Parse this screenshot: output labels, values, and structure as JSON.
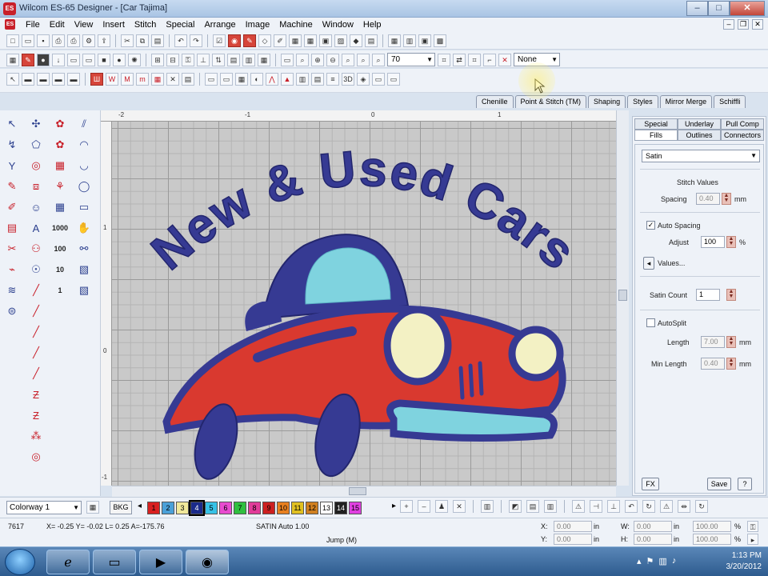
{
  "window": {
    "title": "Wilcom ES-65 Designer - [Car      Tajima]",
    "controls": [
      "–",
      "□",
      "✕"
    ]
  },
  "menu": {
    "items": [
      "File",
      "Edit",
      "View",
      "Insert",
      "Stitch",
      "Special",
      "Arrange",
      "Image",
      "Machine",
      "Window",
      "Help"
    ]
  },
  "toolbar2": {
    "zoom_value": "70",
    "filter_value": "None"
  },
  "docker_tabs": [
    "Chenille",
    "Point & Stitch (TM)",
    "Shaping",
    "Styles",
    "Mirror Merge",
    "Schiffli"
  ],
  "design": {
    "text": "New & Used Cars",
    "colors": {
      "navy": "#363a93",
      "red": "#d9392f",
      "light_blue": "#7fd3df",
      "cream": "#f3f1c4"
    }
  },
  "rulers": {
    "top": [
      "-2",
      "-1",
      "0",
      "1"
    ],
    "left": [
      "1",
      "0",
      "-1"
    ]
  },
  "properties": {
    "tabs_row1": [
      "Special",
      "Underlay",
      "Pull Comp"
    ],
    "tabs_row2": [
      "Fills",
      "Outlines",
      "Connectors"
    ],
    "fill_type": "Satin",
    "section_title": "Stitch Values",
    "spacing_label": "Spacing",
    "spacing_value": "0.40",
    "unit_mm": "mm",
    "auto_spacing_label": "Auto Spacing",
    "adjust_label": "Adjust",
    "adjust_value": "100",
    "unit_pct": "%",
    "values_label": "Values...",
    "satin_count_label": "Satin Count",
    "satin_count_value": "1",
    "autosplit_label": "AutoSplit",
    "length_label": "Length",
    "length_value": "7.00",
    "min_length_label": "Min Length",
    "min_length_value": "0.40",
    "fx_label": "FX",
    "save_label": "Save",
    "help_label": "?"
  },
  "colorbar": {
    "colorway": "Colorway 1",
    "bkg_label": "BKG",
    "swatches": [
      {
        "n": "1",
        "color": "#d82020"
      },
      {
        "n": "2",
        "color": "#4aa0d8"
      },
      {
        "n": "3",
        "color": "#f0e89a"
      },
      {
        "n": "4",
        "color": "#1a2a8a"
      },
      {
        "n": "5",
        "color": "#36c2e6"
      },
      {
        "n": "6",
        "color": "#e84bd0"
      },
      {
        "n": "7",
        "color": "#30c040"
      },
      {
        "n": "8",
        "color": "#e23c9a"
      },
      {
        "n": "9",
        "color": "#cc2020"
      },
      {
        "n": "10",
        "color": "#e88020"
      },
      {
        "n": "11",
        "color": "#e0c020"
      },
      {
        "n": "12",
        "color": "#d08020"
      },
      {
        "n": "13",
        "color": "#ffffff"
      },
      {
        "n": "14",
        "color": "#202020"
      },
      {
        "n": "15",
        "color": "#e040e0"
      }
    ]
  },
  "status": {
    "stitch_count": "7617",
    "coords": "X= -0.25 Y= -0.02 L= 0.25 A=-175.76",
    "stitch_type": "SATIN Auto 1.00",
    "mode": "Jump (M)",
    "x_label": "X:",
    "x_value": "0.00",
    "y_label": "Y:",
    "y_value": "0.00",
    "w_label": "W:",
    "w_value": "0.00",
    "h_label": "H:",
    "h_value": "0.00",
    "unit_in": "in",
    "scale_w": "100.00",
    "scale_h": "100.00",
    "unit_pct": "%"
  },
  "taskbar": {
    "time": "1:13 PM",
    "date": "3/20/2012"
  }
}
